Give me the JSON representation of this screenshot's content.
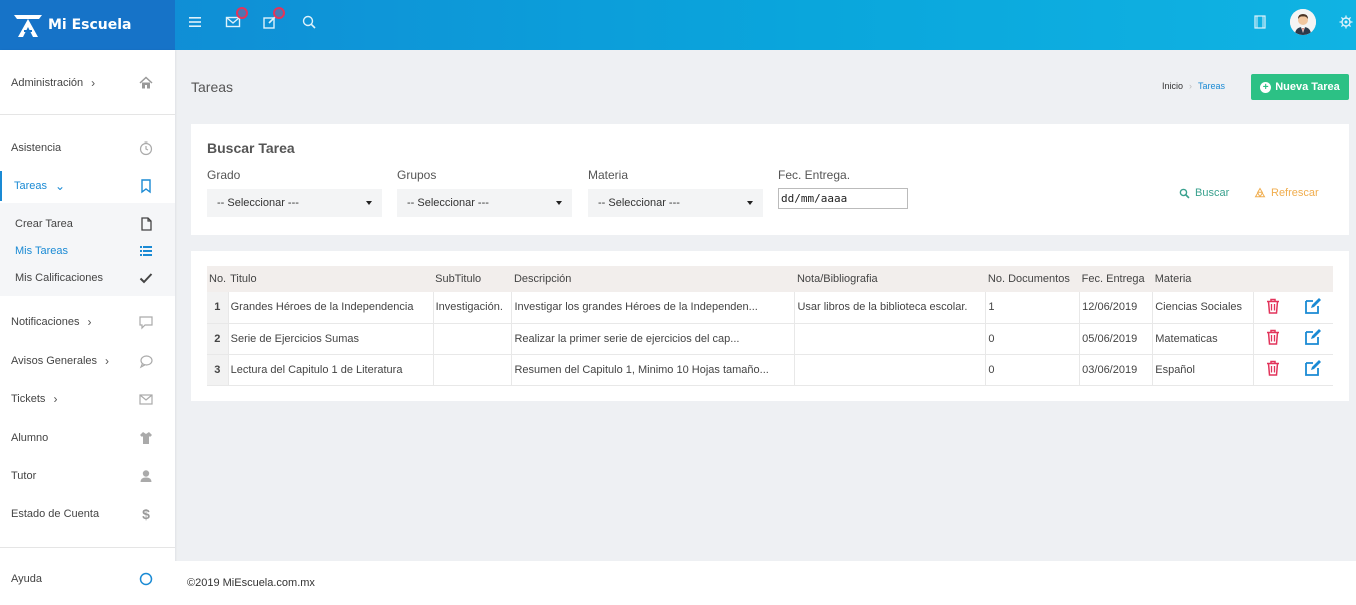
{
  "app": {
    "name": "Mi Escuela"
  },
  "sidebar": {
    "administracion": "Administración",
    "asistencia": "Asistencia",
    "tareas": "Tareas",
    "sub": [
      "Crear Tarea",
      "Mis Tareas",
      "Mis Calificaciones"
    ],
    "notificaciones": "Notificaciones",
    "avisos": "Avisos Generales",
    "tickets": "Tickets",
    "alumno": "Alumno",
    "tutor": "Tutor",
    "estado": "Estado de Cuenta",
    "ayuda": "Ayuda"
  },
  "page": {
    "title": "Tareas",
    "breadcrumb": [
      "Inicio",
      "Tareas"
    ],
    "new_button": "Nueva Tarea"
  },
  "search": {
    "title": "Buscar Tarea",
    "grado_label": "Grado",
    "grupos_label": "Grupos",
    "materia_label": "Materia",
    "fecha_label": "Fec. Entrega.",
    "select_placeholder": "-- Seleccionar ---",
    "date_value": "dd/mm/aaaa",
    "buscar": "Buscar",
    "refrescar": "Refrescar"
  },
  "table": {
    "headers": [
      "No.",
      "Titulo",
      "SubTitulo",
      "Descripción",
      "Nota/Bibliografia",
      "No. Documentos",
      "Fec. Entrega",
      "Materia"
    ],
    "rows": [
      [
        "1",
        "Grandes Héroes de la Independencia",
        "Investigación.",
        "Investigar los grandes Héroes de la Independen...",
        "Usar libros de la biblioteca escolar.",
        "1",
        "12/06/2019",
        "Ciencias Sociales"
      ],
      [
        "2",
        "Serie de Ejercicios Sumas",
        "",
        "Realizar la primer serie de ejercicios del cap...",
        "",
        "0",
        "05/06/2019",
        "Matematicas"
      ],
      [
        "3",
        "Lectura del Capitulo 1 de Literatura",
        "",
        "Resumen del Capitulo 1, Minimo 10 Hojas tamaño...",
        "",
        "0",
        "03/06/2019",
        "Español"
      ]
    ]
  },
  "footer": {
    "text": "©2019 MiEscuela.com.mx"
  },
  "colors": {
    "primary": "#1a8ad4",
    "success": "#2cc185",
    "danger": "#e2345b",
    "warning": "#f0ad4e"
  },
  "icons": [
    "menu-icon",
    "mail-icon",
    "edit-icon",
    "search-icon",
    "fullscreen-icon",
    "settings-icon",
    "home-icon",
    "clock-icon",
    "bookmark-icon",
    "file-icon",
    "list-icon",
    "check-icon",
    "message-icon",
    "chat-icon",
    "envelope-icon",
    "shirt-icon",
    "user-icon",
    "dollar-icon",
    "circle-icon",
    "trash-icon",
    "pencil-icon"
  ]
}
